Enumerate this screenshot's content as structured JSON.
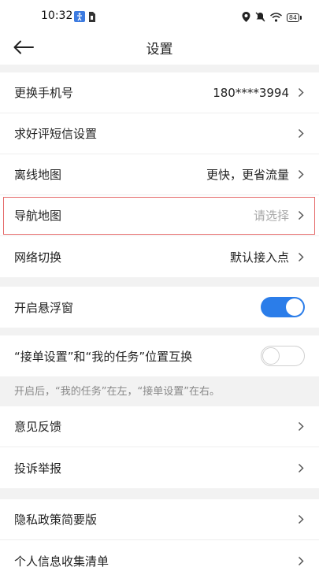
{
  "status_bar": {
    "time": "10:32",
    "battery": "84"
  },
  "header": {
    "title": "设置"
  },
  "group1": [
    {
      "label": "更换手机号",
      "value": "180****3994"
    },
    {
      "label": "求好评短信设置",
      "value": ""
    },
    {
      "label": "离线地图",
      "value": "更快，更省流量"
    },
    {
      "label": "导航地图",
      "value": "请选择"
    },
    {
      "label": "网络切换",
      "value": "默认接入点"
    }
  ],
  "floating_window": {
    "label": "开启悬浮窗",
    "enabled": true
  },
  "swap_position": {
    "label": "“接单设置”和“我的任务”位置互换",
    "enabled": false
  },
  "swap_hint": "开启后，“我的任务”在左，“接单设置”在右。",
  "group3": [
    {
      "label": "意见反馈"
    },
    {
      "label": "投诉举报"
    }
  ],
  "group4": [
    {
      "label": "隐私政策简要版"
    },
    {
      "label": "个人信息收集清单"
    }
  ],
  "colors": {
    "accent": "#2b7de9",
    "highlight": "#e56b6b"
  }
}
